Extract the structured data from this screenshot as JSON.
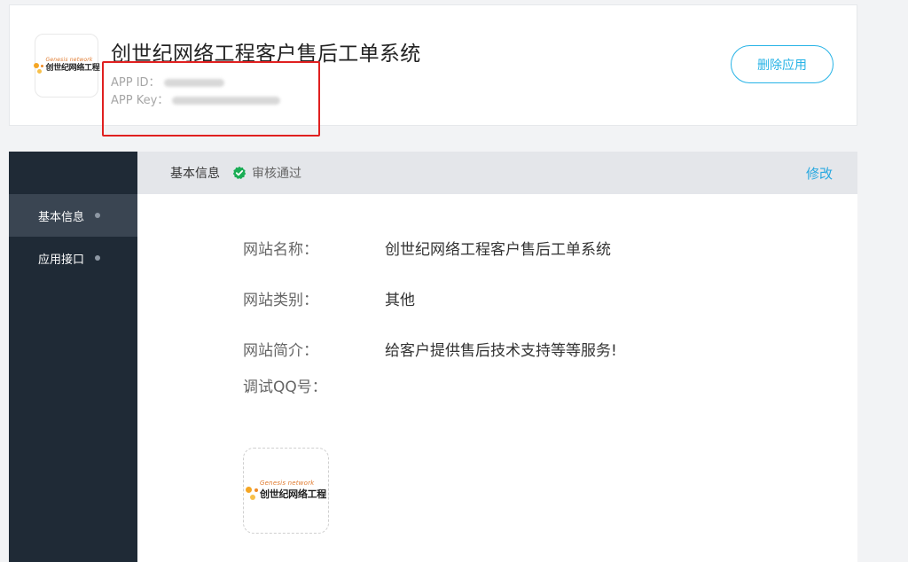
{
  "app": {
    "title": "创世纪网络工程客户售后工单系统",
    "app_id_label": "APP ID：",
    "app_key_label": "APP Key：",
    "delete_label": "删除应用",
    "logo_en": "Genesis network",
    "logo_cn": "创世纪网络工程"
  },
  "sidebar": {
    "items": [
      {
        "label": "基本信息"
      },
      {
        "label": "应用接口"
      }
    ]
  },
  "section": {
    "title": "基本信息",
    "status": "审核通过",
    "edit_label": "修改"
  },
  "fields": [
    {
      "label": "网站名称：",
      "value": "创世纪网络工程客户售后工单系统"
    },
    {
      "label": "网站类别：",
      "value": "其他"
    },
    {
      "label": "网站简介：",
      "value": "给客户提供售后技术支持等等服务!"
    },
    {
      "label": "调试QQ号：",
      "value": ""
    }
  ],
  "colors": {
    "accent": "#27b3e6",
    "sidebar_bg": "#1f2a36",
    "status_green": "#1aad55",
    "highlight_red": "#e02020"
  },
  "icons": {
    "status": "check-badge-icon",
    "sidebar_bullet": "dot-icon"
  }
}
